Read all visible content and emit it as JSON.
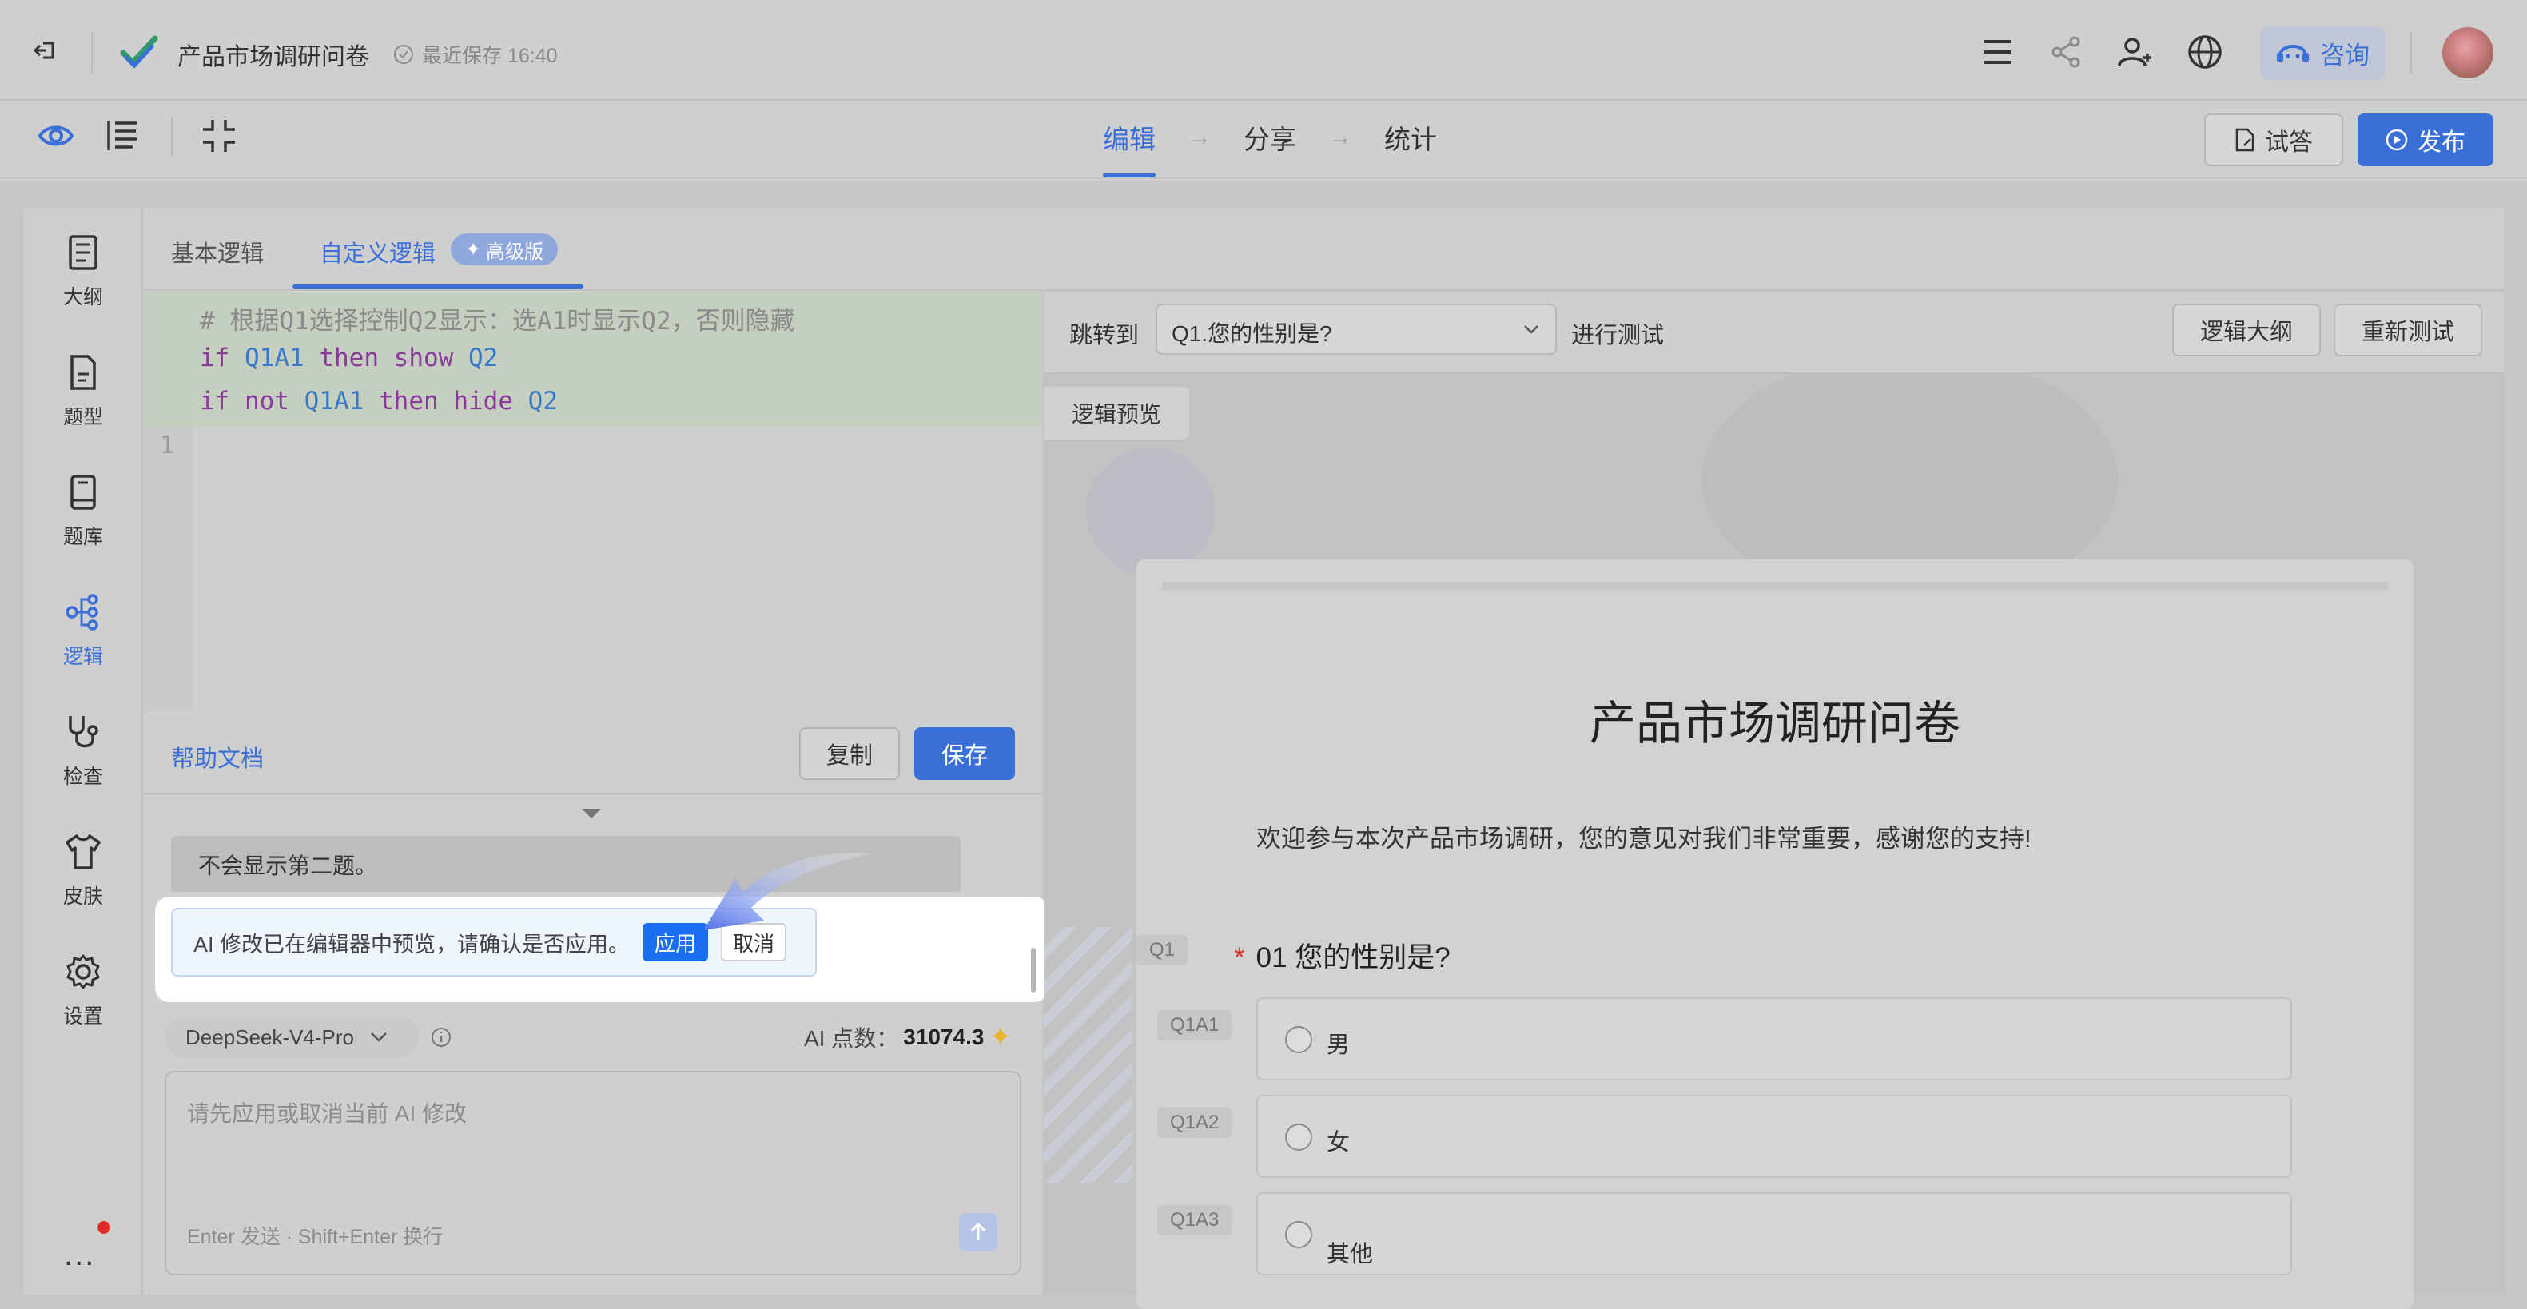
{
  "header": {
    "title": "产品市场调研问卷",
    "saved": "最近保存 16:40",
    "consult": "咨询"
  },
  "subbar": {
    "steps": [
      "编辑",
      "分享",
      "统计"
    ],
    "step_arrow": "→",
    "try_label": "试答",
    "publish_label": "发布"
  },
  "leftnav": {
    "items": [
      {
        "label": "大纲",
        "icon": "outline-icon"
      },
      {
        "label": "题型",
        "icon": "question-type-icon"
      },
      {
        "label": "题库",
        "icon": "question-bank-icon"
      },
      {
        "label": "逻辑",
        "icon": "logic-icon"
      },
      {
        "label": "检查",
        "icon": "check-icon"
      },
      {
        "label": "皮肤",
        "icon": "skin-icon"
      },
      {
        "label": "设置",
        "icon": "settings-icon"
      }
    ],
    "active": "逻辑",
    "more": "..."
  },
  "logic_tabs": {
    "basic": "基本逻辑",
    "custom": "自定义逻辑",
    "badge": "高级版"
  },
  "code": {
    "comment": "# 根据Q1选择控制Q2显示：选A1时显示Q2，否则隐藏",
    "line1": {
      "if": "if",
      "cond": "Q1A1",
      "then": "then",
      "action": "show",
      "target": "Q2"
    },
    "line2": {
      "if": "if",
      "not": "not",
      "cond": "Q1A1",
      "then": "then",
      "action": "hide",
      "target": "Q2"
    },
    "line_number": "1"
  },
  "editor_footer": {
    "help": "帮助文档",
    "copy": "复制",
    "save": "保存"
  },
  "chat": {
    "message": "不会显示第二题。",
    "ai_notice": "AI 修改已在编辑器中预览，请确认是否应用。",
    "apply": "应用",
    "cancel": "取消",
    "model": "DeepSeek-V4-Pro",
    "points_label": "AI 点数：",
    "points_value": "31074.3",
    "input_placeholder": "请先应用或取消当前 AI 修改",
    "input_hint": "Enter 发送 · Shift+Enter 换行"
  },
  "preview": {
    "jump_label": "跳转到",
    "jump_value": "Q1.您的性别是?",
    "test_label": "进行测试",
    "outline_btn": "逻辑大纲",
    "retest_btn": "重新测试",
    "preview_tag": "逻辑预览"
  },
  "survey": {
    "title": "产品市场调研问卷",
    "description": "欢迎参与本次产品市场调研，您的意见对我们非常重要，感谢您的支持!",
    "question": {
      "tag": "Q1",
      "required": "*",
      "title": "01 您的性别是?",
      "options": [
        {
          "tag": "Q1A1",
          "label": "男"
        },
        {
          "tag": "Q1A2",
          "label": "女"
        },
        {
          "tag": "Q1A3",
          "label": "其他"
        }
      ]
    }
  },
  "colors": {
    "accent": "#3b6fd8",
    "apply_button": "#1a6ff0",
    "notification_dot": "#e12b2b"
  }
}
